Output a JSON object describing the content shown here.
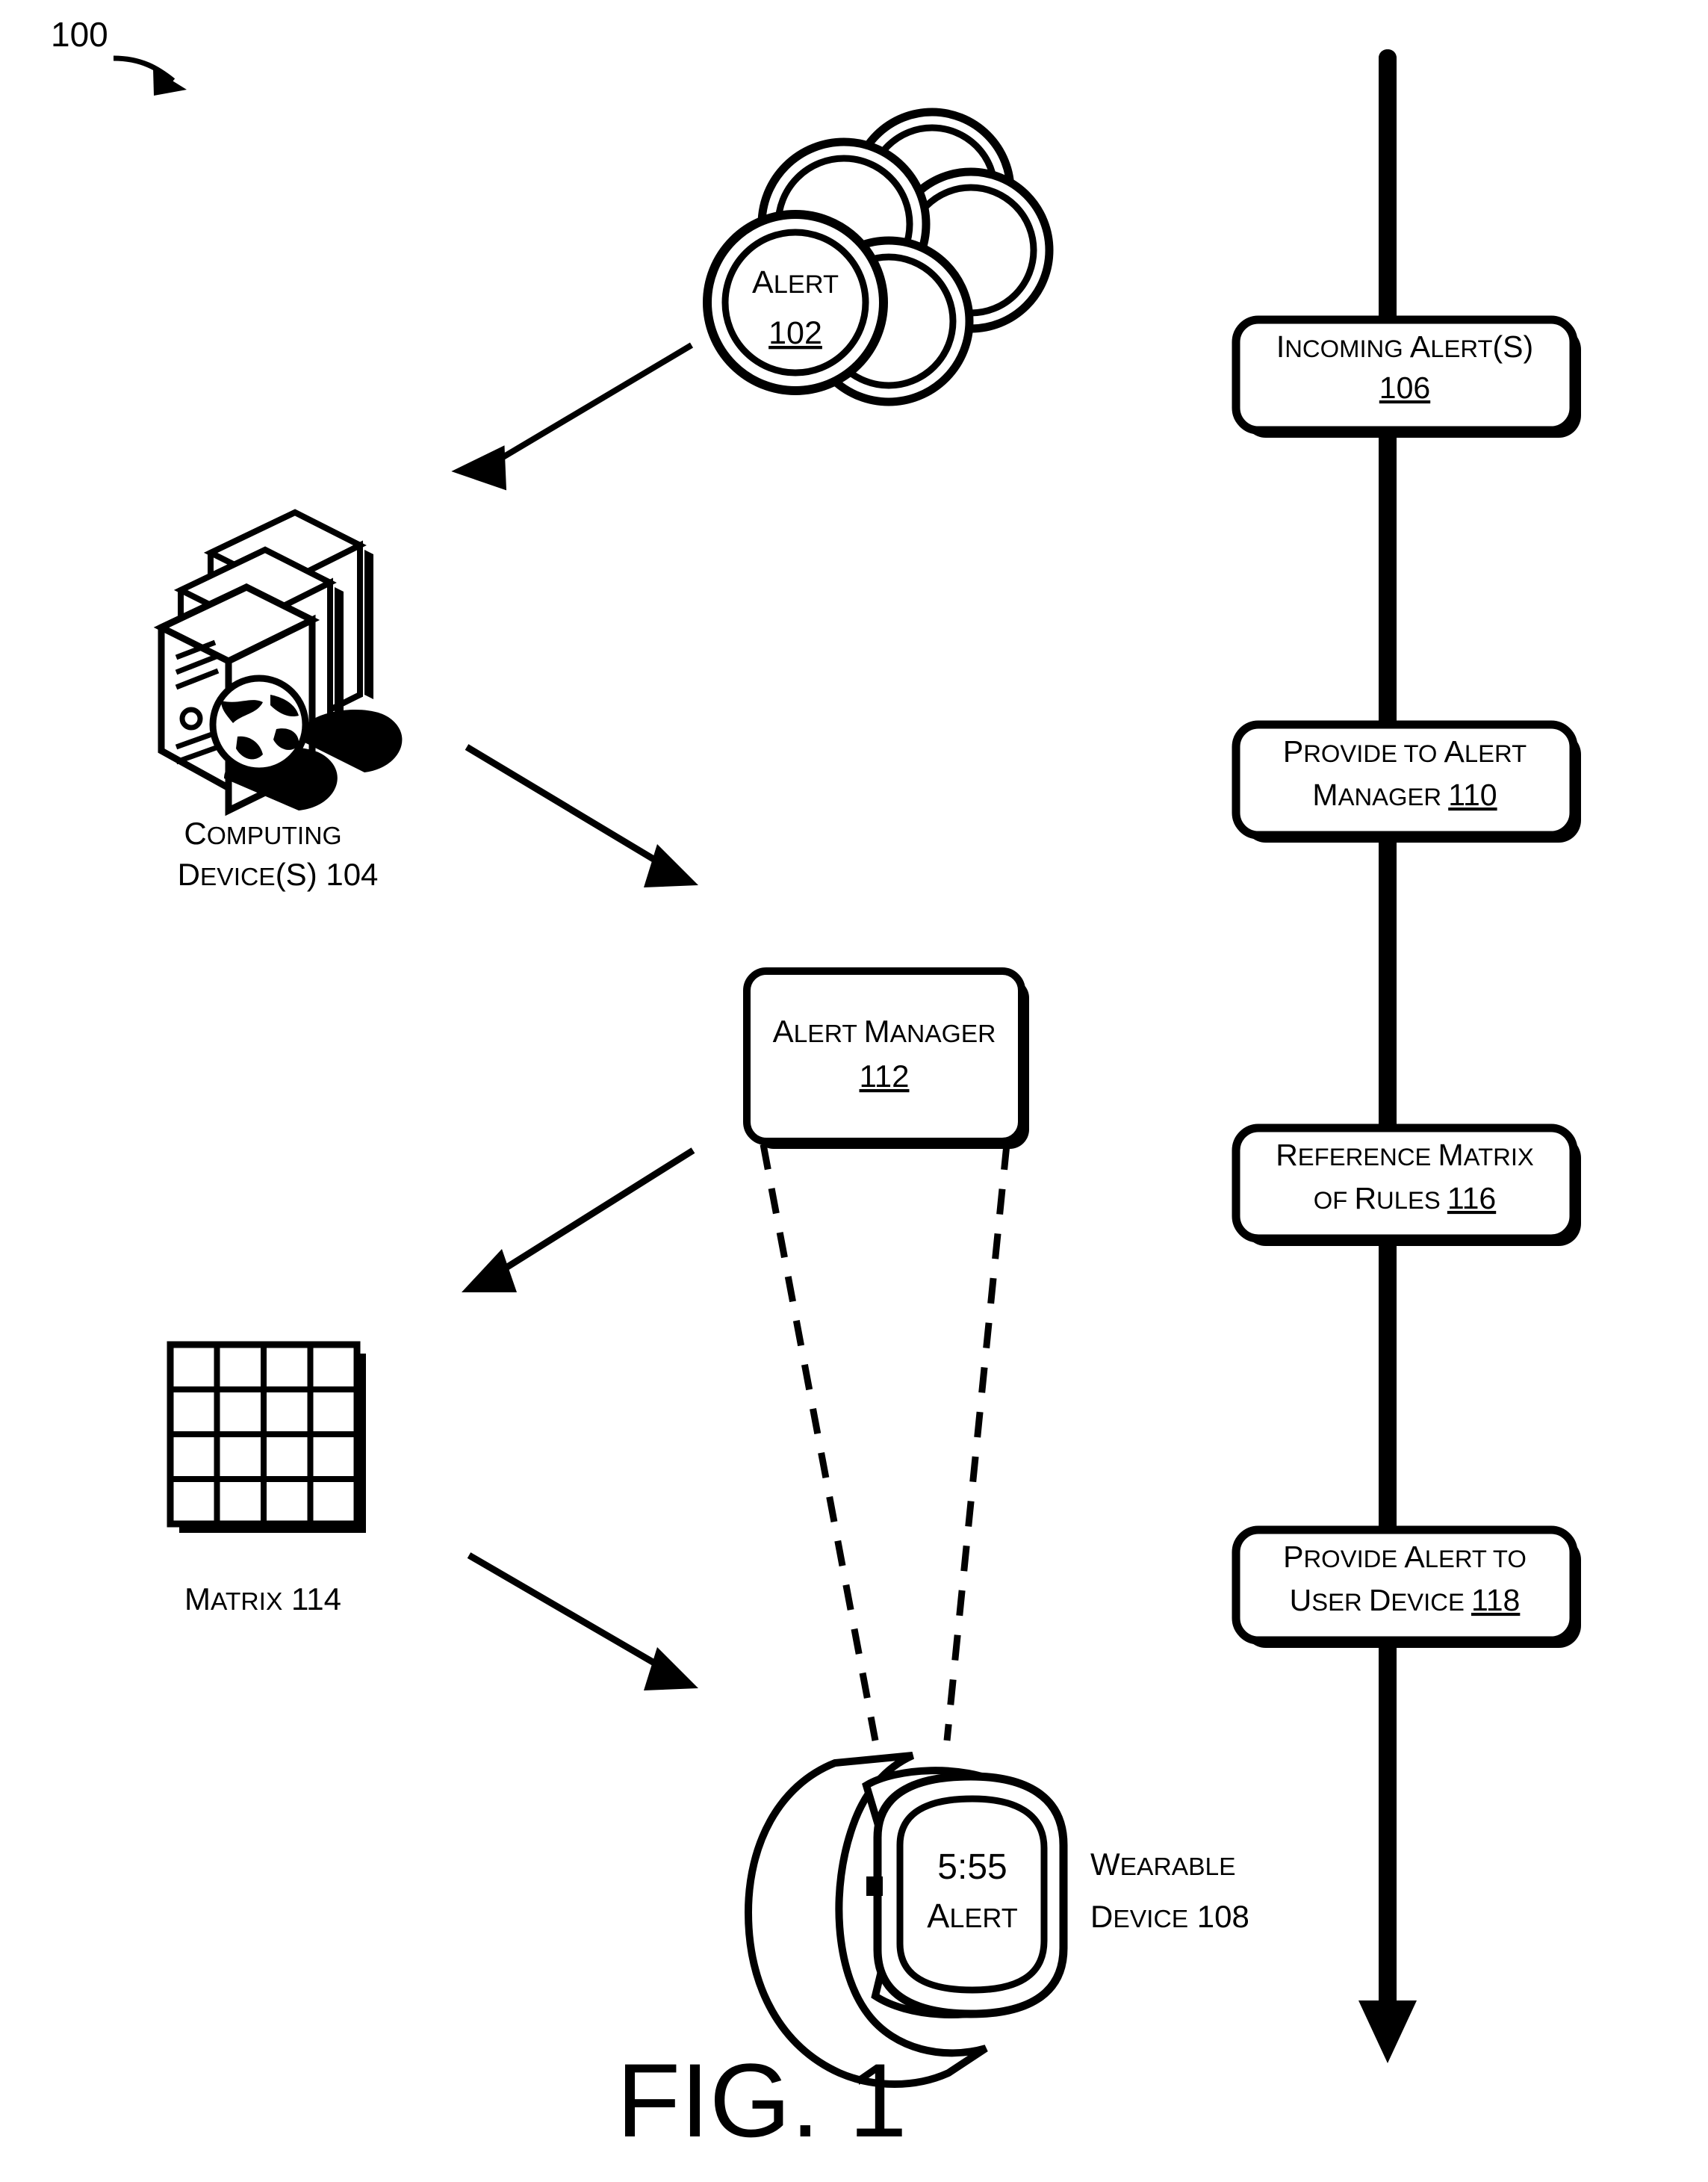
{
  "figure": {
    "caption": "FIG. 1",
    "system_number": "100"
  },
  "entities": {
    "alert_stack": {
      "title": "Alert",
      "ref": "102",
      "count_circles": 5
    },
    "computing_devices": {
      "label_line1": "Computing",
      "label_line2": "Device(s) 104",
      "ref": "104",
      "tower_count": 3
    },
    "alert_manager": {
      "title": "Alert Manager",
      "ref": "112"
    },
    "matrix": {
      "label": "Matrix 114",
      "ref": "114",
      "rows": 4,
      "cols": 4
    },
    "wearable": {
      "screen_time": "5:55",
      "screen_alert": "Alert",
      "label_line1": "Wearable",
      "label_line2": "Device 108",
      "ref": "108"
    }
  },
  "flow": {
    "steps": [
      {
        "line1": "Incoming Alert(s)",
        "line2": "106",
        "ref": "106",
        "number_below": true
      },
      {
        "line1": "Provide to Alert",
        "line2": "Manager 110",
        "ref": "110",
        "number_below": false
      },
      {
        "line1": "Reference Matrix",
        "line2": "of Rules 116",
        "ref": "116",
        "number_below": false
      },
      {
        "line1": "Provide Alert to",
        "line2": "User Device 118",
        "ref": "118",
        "number_below": false
      }
    ]
  },
  "connectors": [
    {
      "name": "alerts-to-computing-devices",
      "style": "solid-arrow"
    },
    {
      "name": "computing-devices-to-alert-manager",
      "style": "solid-arrow"
    },
    {
      "name": "alert-manager-to-matrix",
      "style": "solid-arrow"
    },
    {
      "name": "matrix-to-wearable",
      "style": "solid-arrow"
    },
    {
      "name": "alert-manager-to-wearable-left",
      "style": "dashed"
    },
    {
      "name": "alert-manager-to-wearable-right",
      "style": "dashed"
    },
    {
      "name": "flow-spine",
      "style": "thick-down-arrow"
    }
  ],
  "colors": {
    "ink": "#000000",
    "paper": "#ffffff"
  }
}
